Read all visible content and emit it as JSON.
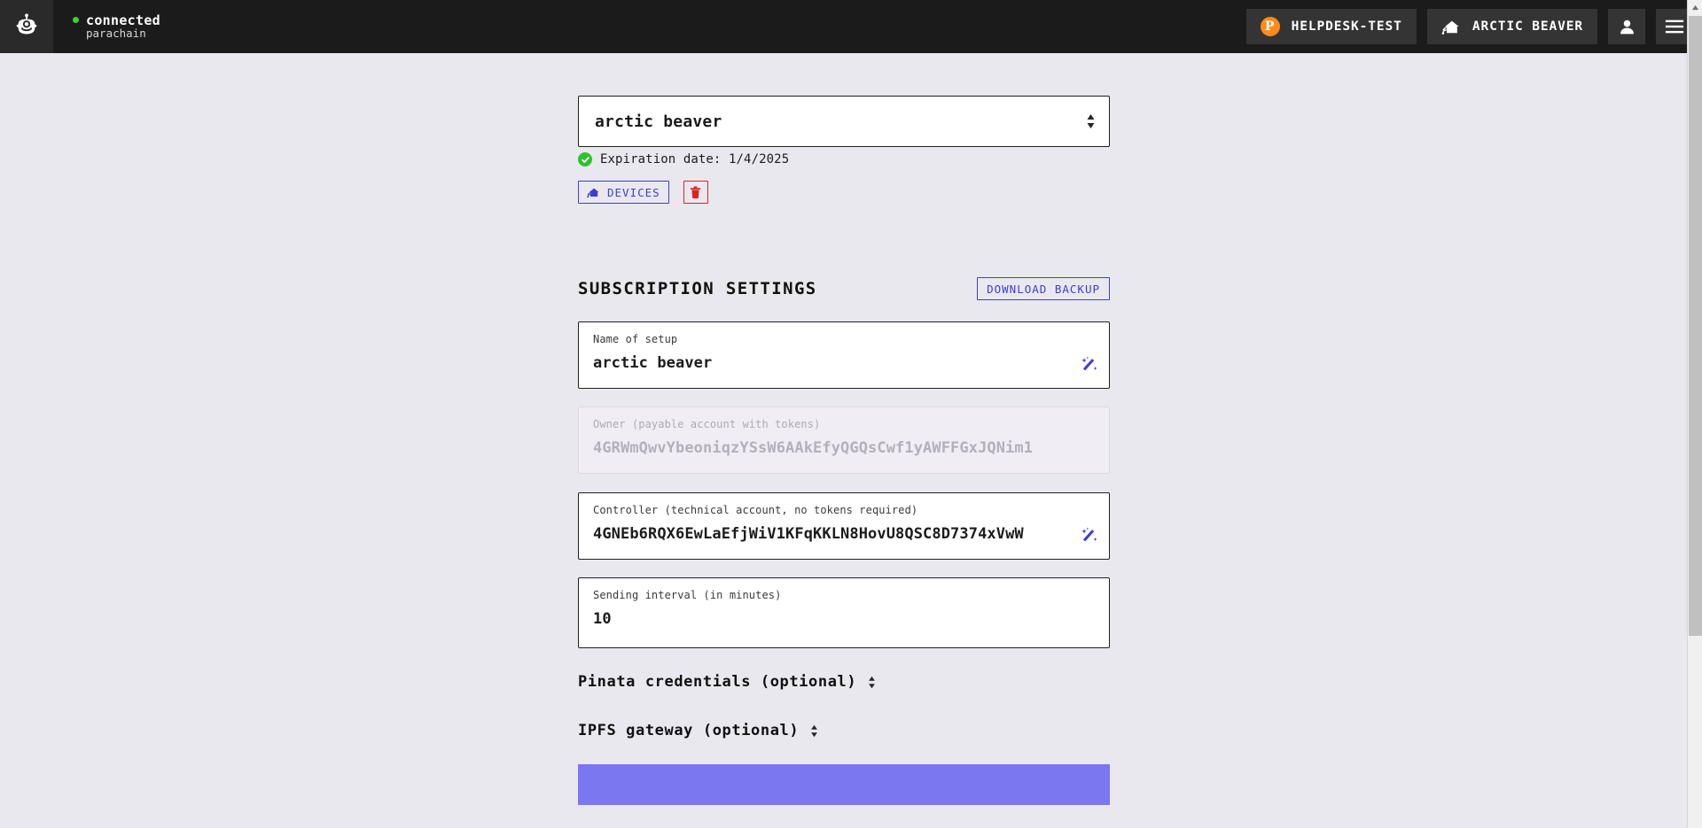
{
  "header": {
    "logo_icon": "robot-head-icon",
    "status": {
      "state": "connected",
      "network": "parachain",
      "dot_color": "#3ad13a"
    },
    "chain_button": {
      "label": "HELPDESK-TEST",
      "icon": "polkadot-icon",
      "icon_glyph": "P",
      "icon_color": "#ff8c1a"
    },
    "device_button": {
      "label": "ARCTIC BEAVER",
      "icon": "house-wifi-icon"
    },
    "account_button": {
      "icon": "person-icon"
    },
    "menu_button": {
      "icon": "hamburger-menu-icon"
    },
    "background": "#1b1b1b"
  },
  "setup_selector": {
    "selected": "arctic beaver",
    "dropdown_icon": "chevron-up-down-icon",
    "status_icon": "check-circle-icon",
    "status_color": "#2fc22f",
    "expiration_text": "Expiration date: 1/4/2025",
    "devices_button": {
      "label": "DEVICES",
      "icon": "house-wifi-icon",
      "color": "#3d3dd6"
    },
    "delete_button": {
      "icon": "trash-icon",
      "color": "#e02020"
    }
  },
  "subscription_settings": {
    "title": "SUBSCRIPTION SETTINGS",
    "download_backup_label": "DOWNLOAD BACKUP",
    "fields": [
      {
        "label": "Name of setup",
        "value": "arctic beaver",
        "disabled": false,
        "action_icon": "magic-wand-icon"
      },
      {
        "label": "Owner (payable account with tokens)",
        "value": "4GRWmQwvYbeoniqzYSsW6AAkEfyQGQsCwf1yAWFFGxJQNim1",
        "disabled": true,
        "action_icon": null
      },
      {
        "label": "Controller (technical account, no tokens required)",
        "value": "4GNEb6RQX6EwLaEfjWiV1KFqKKLN8HovU8QSC8D7374xVwW",
        "disabled": false,
        "action_icon": "magic-wand-icon"
      },
      {
        "label": "Sending interval (in minutes)",
        "value": "10",
        "disabled": false,
        "action_icon": null
      }
    ],
    "accordions": [
      {
        "label": "Pinata credentials (optional)",
        "icon": "chevron-up-down-icon"
      },
      {
        "label": "IPFS gateway (optional)",
        "icon": "chevron-up-down-icon"
      }
    ],
    "submit_button_color": "#7b77f0"
  },
  "scrollbar": {
    "arrow_icon": "scroll-up-arrow-icon"
  }
}
